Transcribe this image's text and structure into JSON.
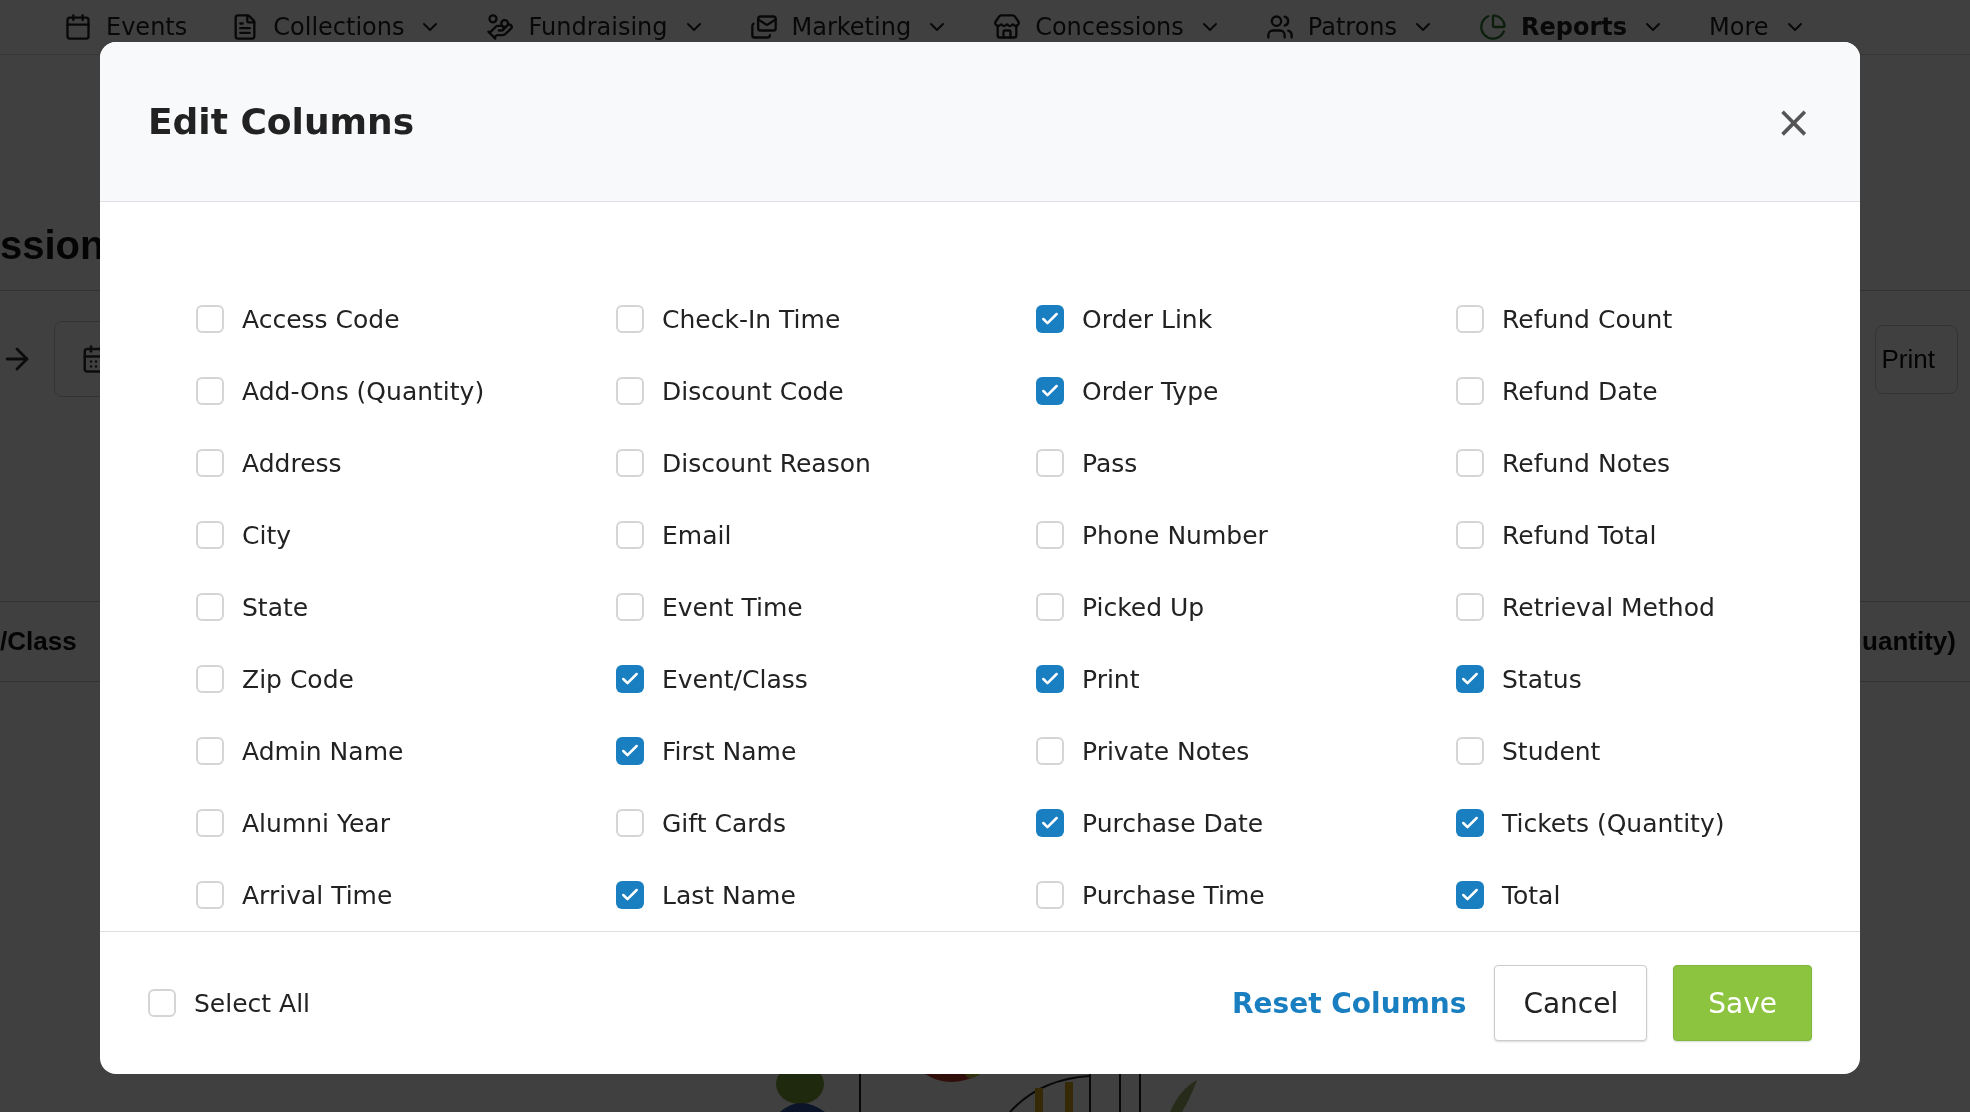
{
  "nav": [
    {
      "label": "Events",
      "has_menu": false,
      "selected": false
    },
    {
      "label": "Collections",
      "has_menu": true,
      "selected": false
    },
    {
      "label": "Fundraising",
      "has_menu": true,
      "selected": false
    },
    {
      "label": "Marketing",
      "has_menu": true,
      "selected": false
    },
    {
      "label": "Concessions",
      "has_menu": true,
      "selected": false
    },
    {
      "label": "Patrons",
      "has_menu": true,
      "selected": false
    },
    {
      "label": "Reports",
      "has_menu": true,
      "selected": true
    },
    {
      "label": "More",
      "has_menu": true,
      "selected": false
    }
  ],
  "page": {
    "heading": "ssion",
    "print_button": "Print",
    "table_headers": [
      "/Class",
      "uantity)"
    ]
  },
  "modal": {
    "title": "Edit Columns",
    "close": "×",
    "columns": [
      {
        "label": "Access Code",
        "checked": false
      },
      {
        "label": "Add-Ons (Quantity)",
        "checked": false
      },
      {
        "label": "Address",
        "checked": false
      },
      {
        "label": "City",
        "checked": false
      },
      {
        "label": "State",
        "checked": false
      },
      {
        "label": "Zip Code",
        "checked": false
      },
      {
        "label": "Admin Name",
        "checked": false
      },
      {
        "label": "Alumni Year",
        "checked": false
      },
      {
        "label": "Arrival Time",
        "checked": false
      },
      {
        "label": "Check-In Time",
        "checked": false
      },
      {
        "label": "Discount Code",
        "checked": false
      },
      {
        "label": "Discount Reason",
        "checked": false
      },
      {
        "label": "Email",
        "checked": false
      },
      {
        "label": "Event Time",
        "checked": false
      },
      {
        "label": "Event/Class",
        "checked": true
      },
      {
        "label": "First Name",
        "checked": true
      },
      {
        "label": "Gift Cards",
        "checked": false
      },
      {
        "label": "Last Name",
        "checked": true
      },
      {
        "label": "Order Link",
        "checked": true
      },
      {
        "label": "Order Type",
        "checked": true
      },
      {
        "label": "Pass",
        "checked": false
      },
      {
        "label": "Phone Number",
        "checked": false
      },
      {
        "label": "Picked Up",
        "checked": false
      },
      {
        "label": "Print",
        "checked": true
      },
      {
        "label": "Private Notes",
        "checked": false
      },
      {
        "label": "Purchase Date",
        "checked": true
      },
      {
        "label": "Purchase Time",
        "checked": false
      },
      {
        "label": "Refund Count",
        "checked": false
      },
      {
        "label": "Refund Date",
        "checked": false
      },
      {
        "label": "Refund Notes",
        "checked": false
      },
      {
        "label": "Refund Total",
        "checked": false
      },
      {
        "label": "Retrieval Method",
        "checked": false
      },
      {
        "label": "Status",
        "checked": true
      },
      {
        "label": "Student",
        "checked": false
      },
      {
        "label": "Tickets (Quantity)",
        "checked": true
      },
      {
        "label": "Total",
        "checked": true
      }
    ],
    "select_all": {
      "label": "Select All",
      "checked": false
    },
    "reset": "Reset Columns",
    "cancel": "Cancel",
    "save": "Save"
  }
}
